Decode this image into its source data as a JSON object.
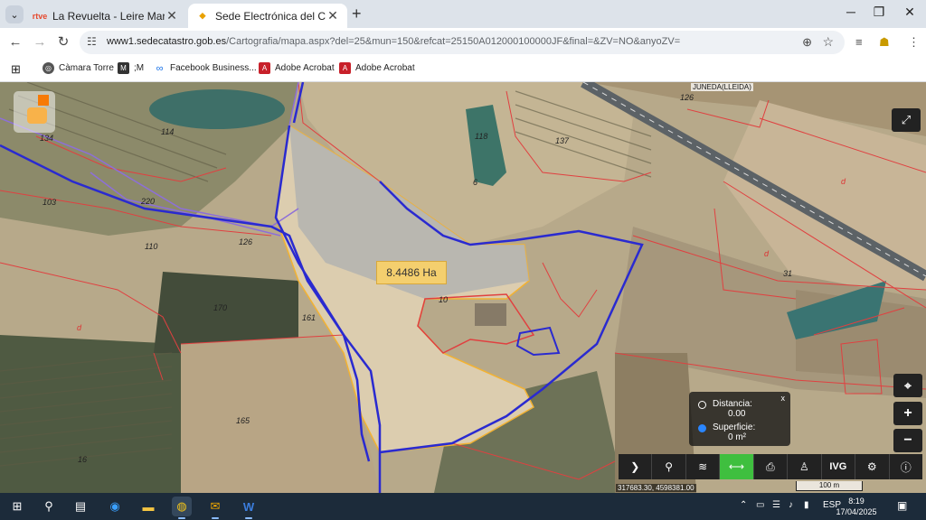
{
  "browser": {
    "tabs": [
      {
        "favicon": "rtve",
        "title": "La Revuelta - Leire Martínez y F"
      },
      {
        "favicon": "catastro",
        "title": "Sede Electrónica del Catastro -"
      }
    ],
    "url": "www1.sedecatastro.gob.es/Cartografia/mapa.aspx?del=25&mun=150&refcat=25150A012000100000JF&final=&ZV=NO&anyoZV=",
    "url_host": "www1.sedecatastro.gob.es",
    "url_path": "/Cartografia/mapa.aspx?del=25&mun=150&refcat=25150A012000100000JF&final=&ZV=NO&anyoZV="
  },
  "bookmarks": [
    {
      "icon": "globe-icon",
      "label": "Càmara Torre"
    },
    {
      "icon": "m-icon",
      "label": ";M"
    },
    {
      "icon": "meta-icon",
      "label": "Facebook Business..."
    },
    {
      "icon": "acrobat-icon",
      "label": "Adobe Acrobat"
    },
    {
      "icon": "acrobat-icon",
      "label": "Adobe Acrobat"
    }
  ],
  "map": {
    "area_label": "8.4486 Ha",
    "road_label": "JUNEDA(LLEIDA)",
    "parcels": [
      "134",
      "114",
      "220",
      "103",
      "110",
      "126",
      "128",
      "137",
      "118",
      "6",
      "126",
      "31",
      "10",
      "170",
      "161",
      "165",
      "16",
      "d",
      "d",
      "d"
    ],
    "measure": {
      "distance_label": "Distancia:",
      "distance_value": "0.00",
      "surface_label": "Superficie:",
      "surface_value": "0 m²",
      "selected": "surface"
    },
    "tools": [
      "chevron-right-icon",
      "search-icon",
      "layers-icon",
      "measure-icon",
      "print-icon",
      "street-view-icon",
      "IVG",
      "bicycle-icon",
      "info-icon"
    ],
    "tool_ivg_label": "IVG",
    "active_tool": "measure-icon",
    "coordinates": "317683.30, 4598381.00",
    "scale": "100 m",
    "colors": {
      "parcel_outline": "#e04040",
      "selection_outline": "#f2b233",
      "boundary": "#2a2ad0",
      "active_tool": "#3fbf3f"
    }
  },
  "taskbar": {
    "apps": [
      "windows-icon",
      "search-icon",
      "task-view-icon",
      "edge-icon",
      "explorer-icon",
      "chrome-icon",
      "outlook-icon",
      "word-icon"
    ],
    "language": "ESP",
    "time": "8:19",
    "date": "17/04/2025"
  }
}
